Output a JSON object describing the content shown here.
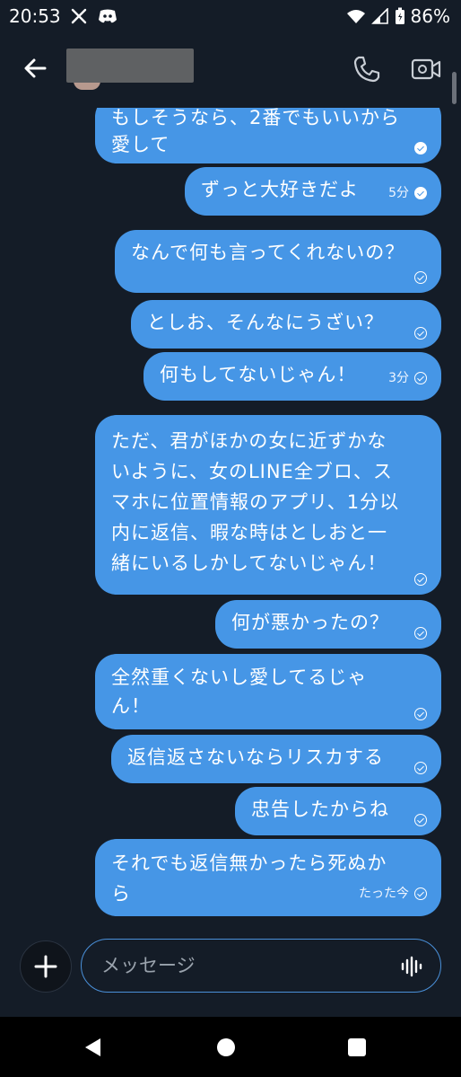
{
  "status": {
    "time": "20:53",
    "apps": [
      "x-icon",
      "discord-icon"
    ],
    "battery": "86%"
  },
  "header": {
    "icons": [
      "back-arrow-icon",
      "phone-icon",
      "video-camera-icon"
    ]
  },
  "messages": [
    {
      "text": "もしそうなら、2番でもいいから\n愛して",
      "time": "",
      "read": "filled"
    },
    {
      "text": "ずっと大好きだよ",
      "time": "5分",
      "read": "filled"
    },
    {
      "text": "なんで何も言ってくれないの？",
      "time": "",
      "read": "outline"
    },
    {
      "text": "としお、そんなにうざい？",
      "time": "",
      "read": "outline"
    },
    {
      "text": "何もしてないじゃん！",
      "time": "3分",
      "read": "outline"
    },
    {
      "text": "ただ、君がほかの女に近ずかな\nいように、女のLINE全ブロ、ス\nマホに位置情報のアプリ、1分以\n内に返信、暇な時はとしおと一\n緒にいるしかしてないじゃん！",
      "time": "",
      "read": "outline"
    },
    {
      "text": "何が悪かったの？",
      "time": "",
      "read": "outline"
    },
    {
      "text": "全然重くないし愛してるじゃ\nん！",
      "time": "",
      "read": "outline"
    },
    {
      "text": "返信返さないならリスカする",
      "time": "",
      "read": "outline"
    },
    {
      "text": "忠告したからね",
      "time": "",
      "read": "outline"
    },
    {
      "text": "それでも返信無かったら死ぬか\nら",
      "time": "たった今",
      "read": "outline"
    }
  ],
  "composer": {
    "placeholder": "メッセージ"
  },
  "accent_color": "#4696e6",
  "background_color": "#141c27"
}
